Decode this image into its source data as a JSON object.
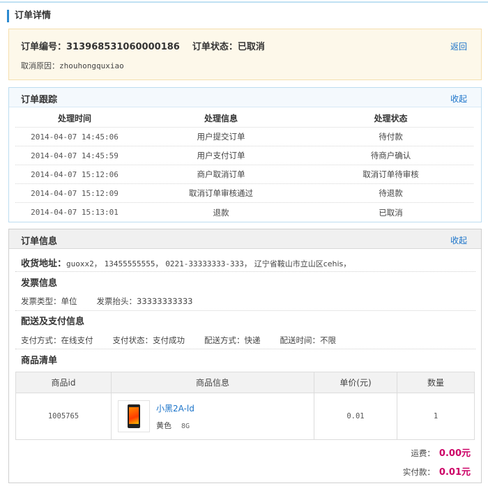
{
  "page": {
    "title": "订单详情"
  },
  "summary": {
    "order_no_label": "订单编号：",
    "order_no": "313968531060000186",
    "status_label": "订单状态：",
    "status": "已取消",
    "back": "返回",
    "cancel_reason_label": "取消原因：",
    "cancel_reason": "zhouhongquxiao"
  },
  "tracking": {
    "title": "订单跟踪",
    "toggle": "收起",
    "headers": [
      "处理时间",
      "处理信息",
      "处理状态"
    ],
    "rows": [
      {
        "time": "2014-04-07 14:45:06",
        "info": "用户提交订单",
        "state": "待付款"
      },
      {
        "time": "2014-04-07 14:45:59",
        "info": "用户支付订单",
        "state": "待商户确认"
      },
      {
        "time": "2014-04-07 15:12:06",
        "info": "商户取消订单",
        "state": "取消订单待审核"
      },
      {
        "time": "2014-04-07 15:12:09",
        "info": "取消订单审核通过",
        "state": "待退款"
      },
      {
        "time": "2014-04-07 15:13:01",
        "info": "退款",
        "state": "已取消"
      }
    ]
  },
  "info": {
    "title": "订单信息",
    "toggle": "收起",
    "address_label": "收货地址：",
    "address_parts": [
      "guoxx2，",
      "13455555555，",
      "0221-33333333-333，",
      "辽宁省鞍山市立山区cehis，"
    ],
    "invoice_title": "发票信息",
    "invoice_type": "发票类型：单位",
    "invoice_head": "发票抬头：33333333333",
    "delivery_title": "配送及支付信息",
    "pay_method": "支付方式：在线支付",
    "pay_status": "支付状态：支付成功",
    "ship_method": "配送方式：快递",
    "ship_time": "配送时间：不限",
    "goods_title": "商品清单",
    "goods_headers": [
      "商品id",
      "商品信息",
      "单价(元)",
      "数量"
    ],
    "goods": [
      {
        "id": "1005765",
        "name": "小黑2A-ld",
        "color": "黄色",
        "size": "8G",
        "price": "0.01",
        "qty": "1"
      }
    ],
    "shipping_fee_label": "运费：",
    "shipping_fee": "0.00元",
    "paid_label": "实付款：",
    "paid": "0.01元"
  },
  "colors": {
    "accent": "#2b8ad0",
    "link": "#1a73c9",
    "price": "#cc0066"
  }
}
